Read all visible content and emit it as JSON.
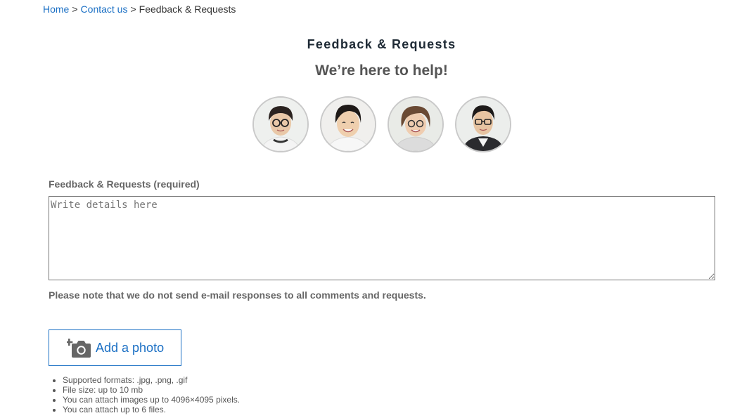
{
  "breadcrumb": {
    "home": "Home",
    "contact": "Contact us",
    "current": "Feedback & Requests",
    "separator": ">"
  },
  "header": {
    "title": "Feedback & Requests",
    "subtitle": "We’re here to help!"
  },
  "form": {
    "label": "Feedback & Requests (required)",
    "placeholder": "Write details here",
    "value": "",
    "note": "Please note that we do not send e-mail responses to all comments and requests."
  },
  "photo": {
    "button_label": "Add a photo",
    "icon": "add-camera-icon",
    "notes": [
      "Supported formats: .jpg, .png, .gif",
      "File size: up to 10 mb",
      "You can attach images up to 4096×4095 pixels.",
      "You can attach up to 6 files."
    ]
  },
  "colors": {
    "link": "#1a6fc4",
    "title": "#1e2a35",
    "muted": "#666666",
    "border": "#767676"
  }
}
